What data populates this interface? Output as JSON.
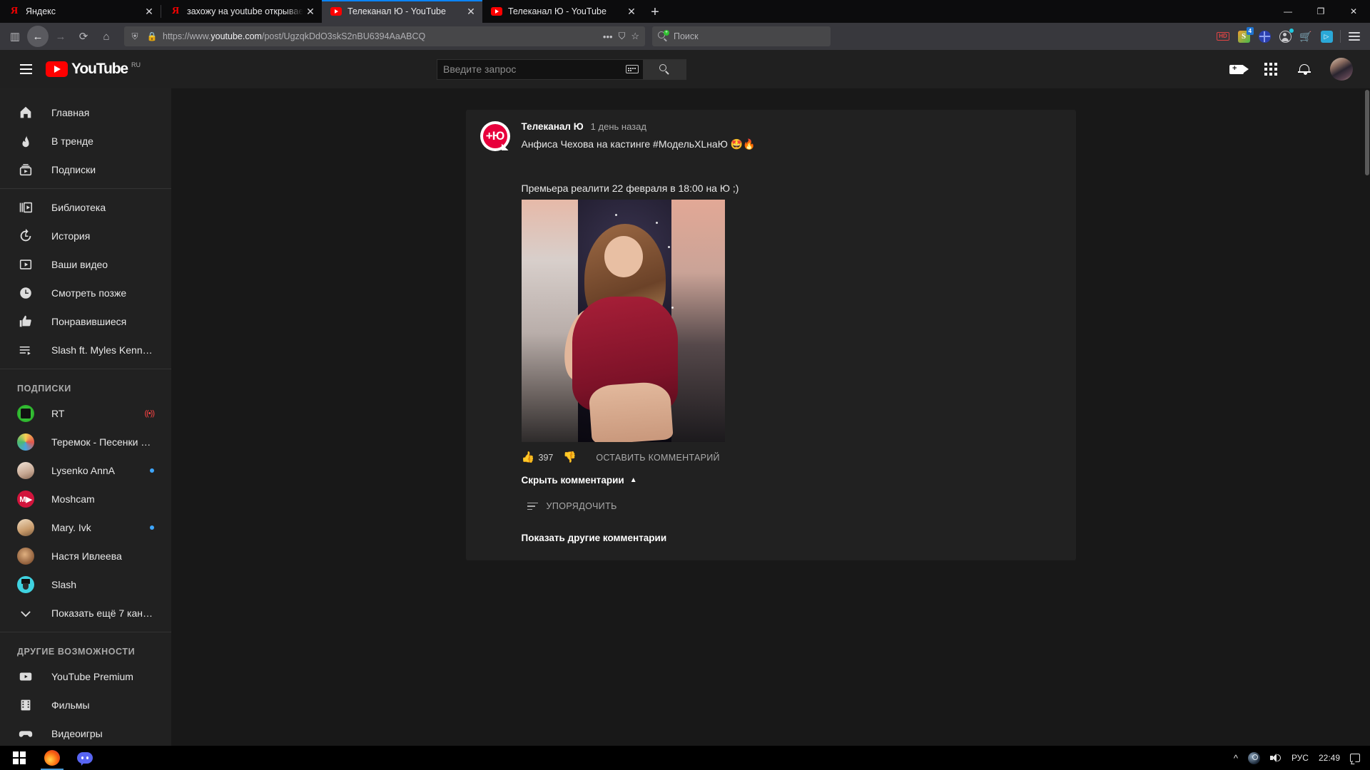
{
  "browser": {
    "tabs": [
      {
        "title": "Яндекс",
        "favicon": "yandex-icon",
        "active": false
      },
      {
        "title": "захожу на youtube открывается",
        "favicon": "yandex-icon",
        "active": false
      },
      {
        "title": "Телеканал Ю - YouTube",
        "favicon": "youtube-icon",
        "active": true
      },
      {
        "title": "Телеканал Ю - YouTube",
        "favicon": "youtube-icon",
        "active": false
      }
    ],
    "new_tab_label": "+",
    "window_controls": {
      "minimize": "—",
      "restore": "❐",
      "close": "✕"
    },
    "nav": {
      "back": "←",
      "forward": "→",
      "reload": "⟳",
      "home": "⌂",
      "sidebar": "▥"
    },
    "url": {
      "scheme": "https://www.",
      "domain": "youtube.com",
      "path": "/post/UgzqkDdO3skS2nBU6394AaABCQ"
    },
    "url_actions": {
      "more": "•••",
      "pocket": "⛉",
      "bookmark": "☆"
    },
    "search": {
      "placeholder": "Поиск",
      "icon": "search-add-icon"
    },
    "extensions": [
      {
        "name": "hd-icon",
        "label": "HD"
      },
      {
        "name": "savefrom-icon",
        "label": "S",
        "badge": "4"
      },
      {
        "name": "globe-icon",
        "label": ""
      },
      {
        "name": "account-icon",
        "label": ""
      },
      {
        "name": "cart-icon",
        "label": "🛒"
      },
      {
        "name": "video-downloader-icon",
        "label": "▷"
      }
    ],
    "menu_label": "☰"
  },
  "youtube": {
    "logo": {
      "text": "YouTube",
      "country": "RU"
    },
    "search": {
      "placeholder": "Введите запрос",
      "keyboard_icon": "keyboard-icon",
      "submit_icon": "search-icon"
    },
    "header_actions": [
      {
        "name": "create-video-icon"
      },
      {
        "name": "apps-grid-icon"
      },
      {
        "name": "notifications-bell-icon"
      },
      {
        "name": "account-avatar"
      }
    ],
    "sidebar": {
      "primary": [
        {
          "label": "Главная",
          "icon": "home-icon"
        },
        {
          "label": "В тренде",
          "icon": "trending-icon"
        },
        {
          "label": "Подписки",
          "icon": "subscriptions-icon"
        }
      ],
      "library": [
        {
          "label": "Библиотека",
          "icon": "library-icon"
        },
        {
          "label": "История",
          "icon": "history-icon"
        },
        {
          "label": "Ваши видео",
          "icon": "your-videos-icon"
        },
        {
          "label": "Смотреть позже",
          "icon": "watch-later-icon"
        },
        {
          "label": "Понравившиеся",
          "icon": "liked-videos-icon"
        },
        {
          "label": "Slash ft. Myles Kenne…",
          "icon": "playlist-icon"
        }
      ],
      "subscriptions_header": "ПОДПИСКИ",
      "subscriptions": [
        {
          "label": "RT",
          "badge": "live",
          "avatar_color": "#3cc13c"
        },
        {
          "label": "Теремок - Песенки …",
          "badge": "",
          "avatar_color": "#f2f2f2"
        },
        {
          "label": "Lysenko AnnA",
          "badge": "new",
          "avatar_color": "#e8d9cf"
        },
        {
          "label": "Moshcam",
          "badge": "",
          "avatar_color": "#d2143c"
        },
        {
          "label": "Mary. Ivk",
          "badge": "new",
          "avatar_color": "#d8b48a"
        },
        {
          "label": "Настя Ивлеева",
          "badge": "",
          "avatar_color": "#7a4a2a"
        },
        {
          "label": "Slash",
          "badge": "",
          "avatar_color": "#3fd2e0"
        }
      ],
      "show_more": {
        "label": "Показать ещё 7 кан…",
        "icon": "chevron-down-icon"
      },
      "more_header": "ДРУГИЕ ВОЗМОЖНОСТИ",
      "more_items": [
        {
          "label": "YouTube Premium",
          "icon": "youtube-premium-icon"
        },
        {
          "label": "Фильмы",
          "icon": "films-icon"
        },
        {
          "label": "Видеоигры",
          "icon": "gaming-icon"
        }
      ]
    },
    "post": {
      "channel_name": "Телеканал Ю",
      "avatar_text": "+Ю",
      "published": "1 день назад",
      "text_line1": "Анфиса Чехова на кастинге #МодельXLнаЮ 🤩🔥",
      "text_line2": "Премьера реалити 22 февраля в 18:00 на Ю ;)",
      "image_alt": "Анфиса Чехова в красном платье на студийном кресле",
      "like_count": "397",
      "like_icon": "thumb-up-icon",
      "dislike_icon": "thumb-down-icon",
      "comment_action": "ОСТАВИТЬ КОММЕНТАРИЙ",
      "hide_comments": "Скрыть комментарии",
      "hide_comments_icon": "chevron-up-icon",
      "sort_label": "УПОРЯДОЧИТЬ",
      "sort_icon": "sort-icon",
      "more_comments": "Показать другие комментарии"
    }
  },
  "taskbar": {
    "start": "windows-start-icon",
    "apps": [
      {
        "name": "firefox-icon",
        "active": true
      },
      {
        "name": "discord-icon",
        "active": false
      }
    ],
    "tray": {
      "expand_icon": "chevron-up-icon",
      "steam_icon": "steam-icon",
      "volume_icon": "volume-icon",
      "language": "РУС",
      "time": "22:49",
      "notification_icon": "notification-icon"
    }
  },
  "colors": {
    "yt_red": "#ff0000",
    "accent_blue": "#3ea6ff",
    "bg_dark": "#181818",
    "panel": "#212121"
  }
}
